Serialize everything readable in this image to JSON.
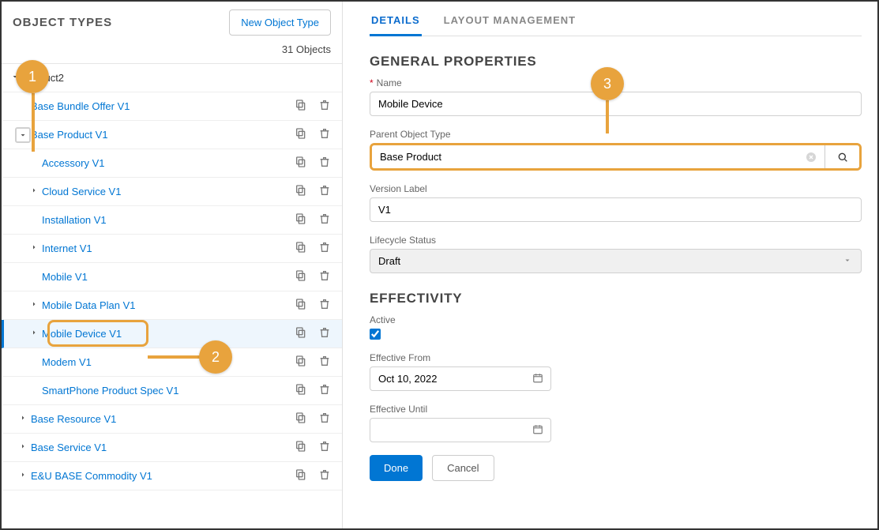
{
  "left": {
    "title": "OBJECT TYPES",
    "new_button": "New Object Type",
    "count_text": "31 Objects",
    "tree": {
      "root_label": "Product2",
      "items": [
        {
          "label": "Base Bundle Offer V1",
          "indent": 1,
          "chev": false,
          "copy": true,
          "del": true
        },
        {
          "label": "Base Product V1",
          "indent": 1,
          "chev": "down",
          "copy": true,
          "del": true,
          "chev_highlight": true
        },
        {
          "label": "Accessory V1",
          "indent": 2,
          "chev": false,
          "copy": true,
          "del": true
        },
        {
          "label": "Cloud Service V1",
          "indent": 2,
          "chev": "right",
          "copy": true,
          "del": true
        },
        {
          "label": "Installation V1",
          "indent": 2,
          "chev": false,
          "copy": true,
          "del": true
        },
        {
          "label": "Internet V1",
          "indent": 2,
          "chev": "right",
          "copy": true,
          "del": true
        },
        {
          "label": "Mobile V1",
          "indent": 2,
          "chev": false,
          "copy": true,
          "del": true
        },
        {
          "label": "Mobile Data Plan V1",
          "indent": 2,
          "chev": "right",
          "copy": true,
          "del": true
        },
        {
          "label": "Mobile Device V1",
          "indent": 2,
          "chev": "right",
          "copy": true,
          "del": true,
          "selected": true,
          "row_highlight": true
        },
        {
          "label": "Modem V1",
          "indent": 2,
          "chev": false,
          "copy": true,
          "del": true
        },
        {
          "label": "SmartPhone Product Spec V1",
          "indent": 2,
          "chev": false,
          "copy": true,
          "del": true
        },
        {
          "label": "Base Resource V1",
          "indent": 1,
          "chev": "right",
          "copy": true,
          "del": true
        },
        {
          "label": "Base Service V1",
          "indent": 1,
          "chev": "right",
          "copy": true,
          "del": true
        },
        {
          "label": "E&U BASE Commodity V1",
          "indent": 1,
          "chev": "right",
          "copy": true,
          "del": true
        }
      ]
    }
  },
  "right": {
    "tabs": {
      "details": "DETAILS",
      "layout": "LAYOUT MANAGEMENT"
    },
    "section_general": "GENERAL PROPERTIES",
    "name_label": "Name",
    "name_value": "Mobile Device",
    "parent_label": "Parent Object Type",
    "parent_value": "Base Product",
    "version_label": "Version Label",
    "version_value": "V1",
    "lifecycle_label": "Lifecycle Status",
    "lifecycle_value": "Draft",
    "section_effectivity": "EFFECTIVITY",
    "active_label": "Active",
    "eff_from_label": "Effective From",
    "eff_from_value": "Oct 10, 2022",
    "eff_until_label": "Effective Until",
    "eff_until_value": "",
    "done": "Done",
    "cancel": "Cancel"
  },
  "callouts": {
    "c1": "1",
    "c2": "2",
    "c3": "3"
  }
}
